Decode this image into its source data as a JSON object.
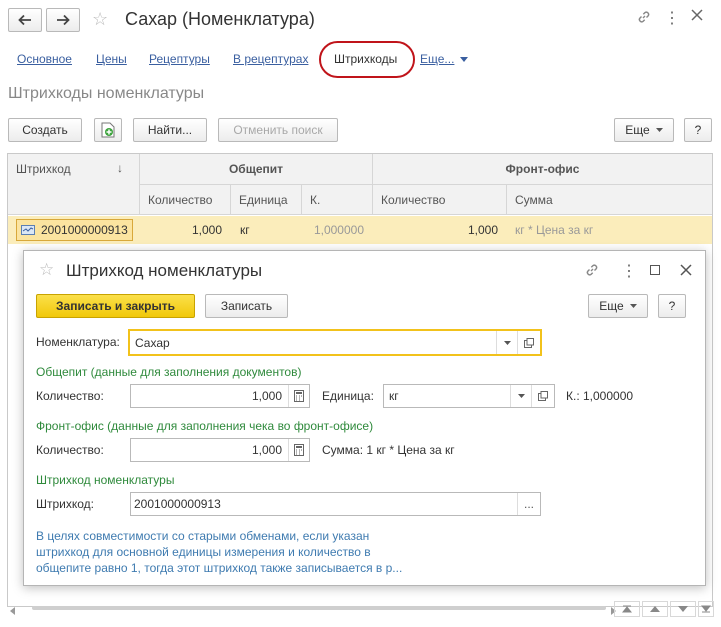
{
  "window": {
    "title": "Сахар (Номенклатура)"
  },
  "tabs": [
    {
      "label": "Основное"
    },
    {
      "label": "Цены"
    },
    {
      "label": "Рецептуры"
    },
    {
      "label": "В рецептурах"
    },
    {
      "label": "Штрихкоды"
    },
    {
      "label": "Еще..."
    }
  ],
  "section_title": "Штрихкоды номенклатуры",
  "toolbar": {
    "create": "Создать",
    "find": "Найти...",
    "cancel_search": "Отменить поиск",
    "more": "Еще",
    "help": "?"
  },
  "table": {
    "headers": {
      "barcode": "Штрихкод",
      "sort": "↓",
      "group1": "Общепит",
      "group2": "Фронт-офис",
      "qty1": "Количество",
      "unit": "Единица",
      "k": "К.",
      "qty2": "Количество",
      "sum": "Сумма"
    },
    "row": {
      "barcode": "2001000000913",
      "qty1": "1,000",
      "unit": "кг",
      "k": "1,000000",
      "qty2": "1,000",
      "sum": "кг * Цена за кг"
    }
  },
  "dialog": {
    "title": "Штрихкод номенклатуры",
    "save_close": "Записать и закрыть",
    "save": "Записать",
    "more": "Еще",
    "help": "?",
    "nomenclature_label": "Номенклатура:",
    "nomenclature_value": "Сахар",
    "group1_title": "Общепит (данные для заполнения документов)",
    "qty_label": "Количество:",
    "qty1_value": "1,000",
    "unit_label": "Единица:",
    "unit_value": "кг",
    "k_text": "К.: 1,000000",
    "group2_title": "Фронт-офис (данные для заполнения чека во фронт-офисе)",
    "qty2_label": "Количество:",
    "qty2_value": "1,000",
    "sum_text": "Сумма: 1 кг * Цена за кг",
    "group3_title": "Штрихкод номенклатуры",
    "barcode_label": "Штрихкод:",
    "barcode_value": "2001000000913",
    "note_line1": "В целях совместимости со старыми обменами, если указан",
    "note_line2": "штрихкод для основной единицы измерения и количество в",
    "note_line3": "общепите равно 1, тогда этот штрихкод также записывается в р..."
  },
  "colors": {
    "accent": "#2f8a3c",
    "selected_row": "#fbedbb",
    "primary_button": "#f5d314",
    "highlight_ring": "#c0141a"
  }
}
